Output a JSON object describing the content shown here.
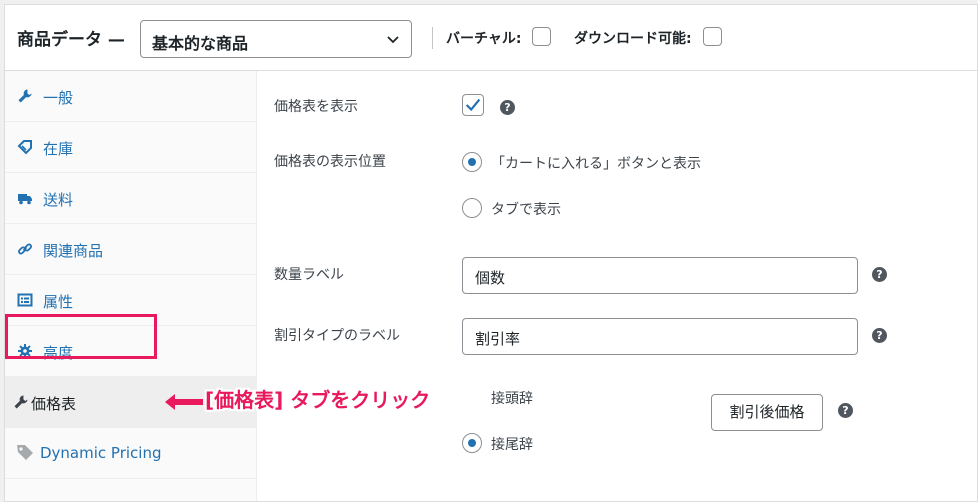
{
  "header": {
    "title": "商品データ —",
    "product_type": "基本的な商品",
    "virtual_label": "バーチャル:",
    "downloadable_label": "ダウンロード可能:"
  },
  "tabs": [
    {
      "label": "一般",
      "icon": "wrench-icon"
    },
    {
      "label": "在庫",
      "icon": "tag-diamond-icon"
    },
    {
      "label": "送料",
      "icon": "truck-icon"
    },
    {
      "label": "関連商品",
      "icon": "link-icon"
    },
    {
      "label": "属性",
      "icon": "list-card-icon"
    },
    {
      "label": "高度",
      "icon": "gear-icon"
    },
    {
      "label": "価格表",
      "icon": "wrench-icon",
      "active": true
    },
    {
      "label": "Dynamic Pricing",
      "icon": "tag-icon"
    }
  ],
  "annotation": "[価格表] タブをクリック",
  "fields": {
    "show_price_table": {
      "label": "価格表を表示",
      "checked": true
    },
    "position": {
      "label": "価格表の表示位置",
      "options": [
        {
          "label": "「カートに入れる」ボタンと表示",
          "selected": true
        },
        {
          "label": "タブで表示",
          "selected": false
        }
      ]
    },
    "quantity_label": {
      "label": "数量ラベル",
      "value": "個数"
    },
    "discount_label": {
      "label": "割引タイプのラベル",
      "value": "割引率"
    },
    "affix": {
      "options": [
        {
          "label": "接頭辞",
          "selected": false
        },
        {
          "label": "接尾辞",
          "selected": true
        }
      ],
      "button_label": "割引後価格"
    }
  },
  "colors": {
    "accent": "#2271b1",
    "annotation": "#e8195c"
  }
}
